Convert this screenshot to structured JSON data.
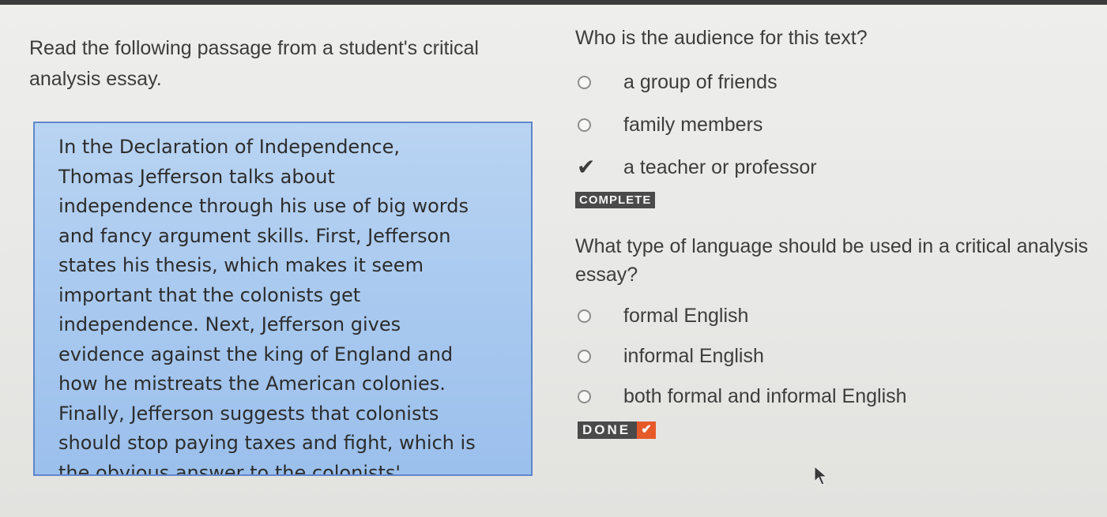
{
  "intro": "Read the following passage from a student's critical analysis essay.",
  "passage": "In the Declaration of Independence,\nThomas Jefferson talks about\nindependence through his use of big words\nand fancy argument skills. First, Jefferson\nstates his thesis, which makes it seem\nimportant that the colonists get\nindependence. Next, Jefferson gives\nevidence against the king of England and\nhow he mistreats the American colonies.\nFinally, Jefferson suggests that colonists\nshould stop paying taxes and fight, which is\nthe obvious answer to the colonists'",
  "question1": {
    "prompt": "Who is the audience for this text?",
    "options": [
      {
        "label": "a group of friends",
        "state": "unselected"
      },
      {
        "label": "family members",
        "state": "unselected"
      },
      {
        "label": "a teacher or professor",
        "state": "correct-check"
      }
    ],
    "status_badge": "COMPLETE"
  },
  "question2": {
    "prompt": "What type of language should be used in a critical analysis essay?",
    "options": [
      {
        "label": "formal English",
        "state": "unselected"
      },
      {
        "label": "informal English",
        "state": "unselected"
      },
      {
        "label": "both formal and informal English",
        "state": "unselected"
      }
    ],
    "done_badge": "DONE",
    "done_icon": "check-icon"
  },
  "colors": {
    "passage_bg": "#a9c9ef",
    "passage_border": "#5f87c9",
    "done_check_bg": "#e65a2a",
    "badge_bg": "#4a4a4a"
  }
}
